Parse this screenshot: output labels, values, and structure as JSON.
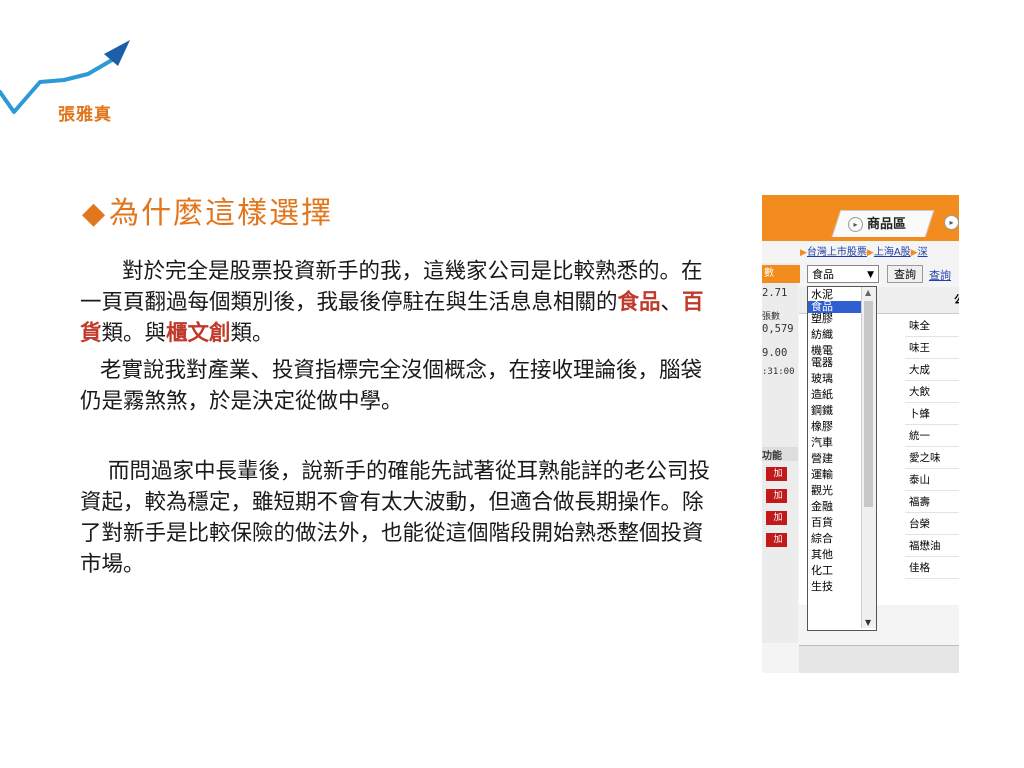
{
  "author": "張雅真",
  "heading": {
    "bullet": "◆",
    "title": "為什麼這樣選擇"
  },
  "paragraphs": {
    "p1_a": "對於完全是股票投資新手的我，這幾家公司是比較熟悉的。在一頁頁翻過每個類別後，我最後停駐在與生活息息相關的",
    "p1_h1": "食品",
    "p1_b": "、",
    "p1_h2": "百貨",
    "p1_c": "類。與",
    "p1_h3": "櫃文創",
    "p1_d": "類。",
    "p2": "老實說我對產業、投資指標完全沒個概念，在接收理論後，腦袋仍是霧煞煞，於是決定從做中學。",
    "p3": "而問過家中長輩後，說新手的確能先試著從耳熟能詳的老公司投資起，較為穩定，雖短期不會有太大波動，但適合做長期操作。除了對新手是比較保險的做法外，也能從這個階段開始熟悉整個投資市場。"
  },
  "screenshot": {
    "tab_label": "商品區",
    "tab_arrow": "▸",
    "links": [
      "台灣上市股票",
      "上海A股",
      "深"
    ],
    "left_panel": {
      "header": "數",
      "values": [
        "2.71",
        "張數",
        "0,579",
        "9.00",
        ":31:00"
      ],
      "subheader": "功能",
      "add_label": "加"
    },
    "select_value": "食品",
    "query_button": "查詢",
    "query_link": "查詢",
    "grid_header": "公",
    "companies": [
      "味全",
      "味王",
      "大成",
      "大飲",
      "卜蜂",
      "統一",
      "愛之味",
      "泰山",
      "福壽",
      "台榮",
      "福懋油",
      "佳格"
    ],
    "dropdown_options": [
      "水泥",
      "食品",
      "塑膠",
      "紡織",
      "機電",
      "電器",
      "玻璃",
      "造紙",
      "鋼鐵",
      "橡膠",
      "汽車",
      "營建",
      "運輸",
      "觀光",
      "金融",
      "百貨",
      "綜合",
      "其他",
      "化工",
      "生技"
    ],
    "selected_option": "食品"
  },
  "colors": {
    "accent": "#e2761d",
    "highlight": "#c0392b",
    "logo_line": "#2b9ad6",
    "logo_arrow": "#1c5fa8"
  }
}
